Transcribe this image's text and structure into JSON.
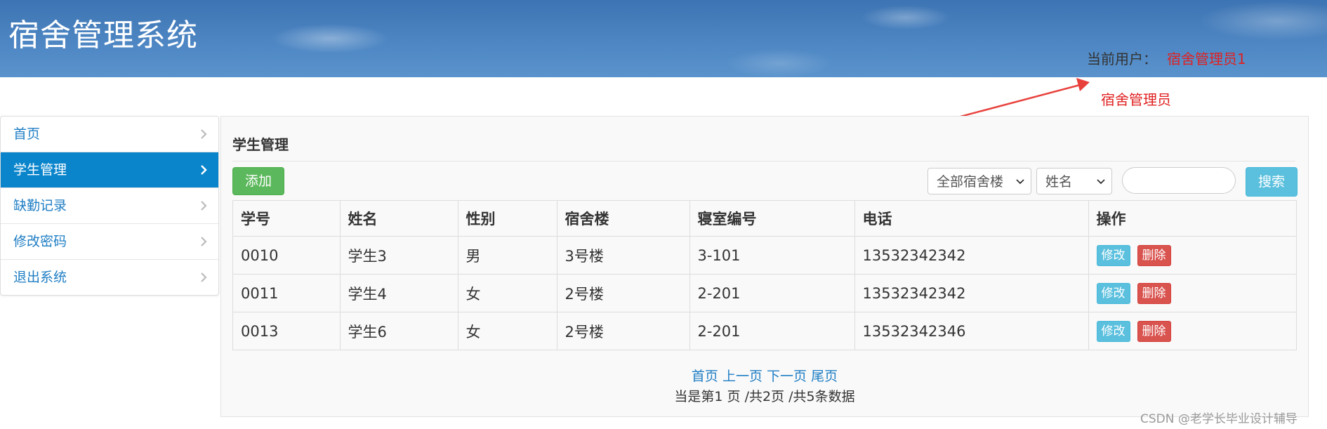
{
  "header": {
    "app_title": "宿舍管理系统",
    "user_label": "当前用户：",
    "user_name": "宿舍管理员1"
  },
  "annotation": {
    "text": "宿舍管理员",
    "color": "#e02020"
  },
  "sidebar": {
    "items": [
      {
        "label": "首页",
        "active": false
      },
      {
        "label": "学生管理",
        "active": true
      },
      {
        "label": "缺勤记录",
        "active": false
      },
      {
        "label": "修改密码",
        "active": false
      },
      {
        "label": "退出系统",
        "active": false
      }
    ]
  },
  "main": {
    "title": "学生管理",
    "toolbar": {
      "add_label": "添加",
      "building_select": "全部宿舍楼",
      "field_select": "姓名",
      "search_value": "",
      "search_label": "搜索"
    },
    "table": {
      "headers": [
        "学号",
        "姓名",
        "性别",
        "宿舍楼",
        "寝室编号",
        "电话",
        "操作"
      ],
      "rows": [
        {
          "id": "0010",
          "name": "学生3",
          "gender": "男",
          "building": "3号楼",
          "room": "3-101",
          "phone": "13532342342",
          "edit": "修改",
          "delete": "删除"
        },
        {
          "id": "0011",
          "name": "学生4",
          "gender": "女",
          "building": "2号楼",
          "room": "2-201",
          "phone": "13532342342",
          "edit": "修改",
          "delete": "删除"
        },
        {
          "id": "0013",
          "name": "学生6",
          "gender": "女",
          "building": "2号楼",
          "room": "2-201",
          "phone": "13532342346",
          "edit": "修改",
          "delete": "删除"
        }
      ]
    },
    "pager": {
      "first": "首页",
      "prev": "上一页",
      "next": "下一页",
      "last": "尾页",
      "info": "当是第1 页 /共2页  /共5条数据"
    }
  },
  "watermark": "CSDN @老学长毕业设计辅导",
  "colors": {
    "accent": "#0a85cc",
    "add": "#5cb85c",
    "search": "#5bc0de",
    "delete": "#d9534f",
    "link": "#1f7ec4"
  }
}
